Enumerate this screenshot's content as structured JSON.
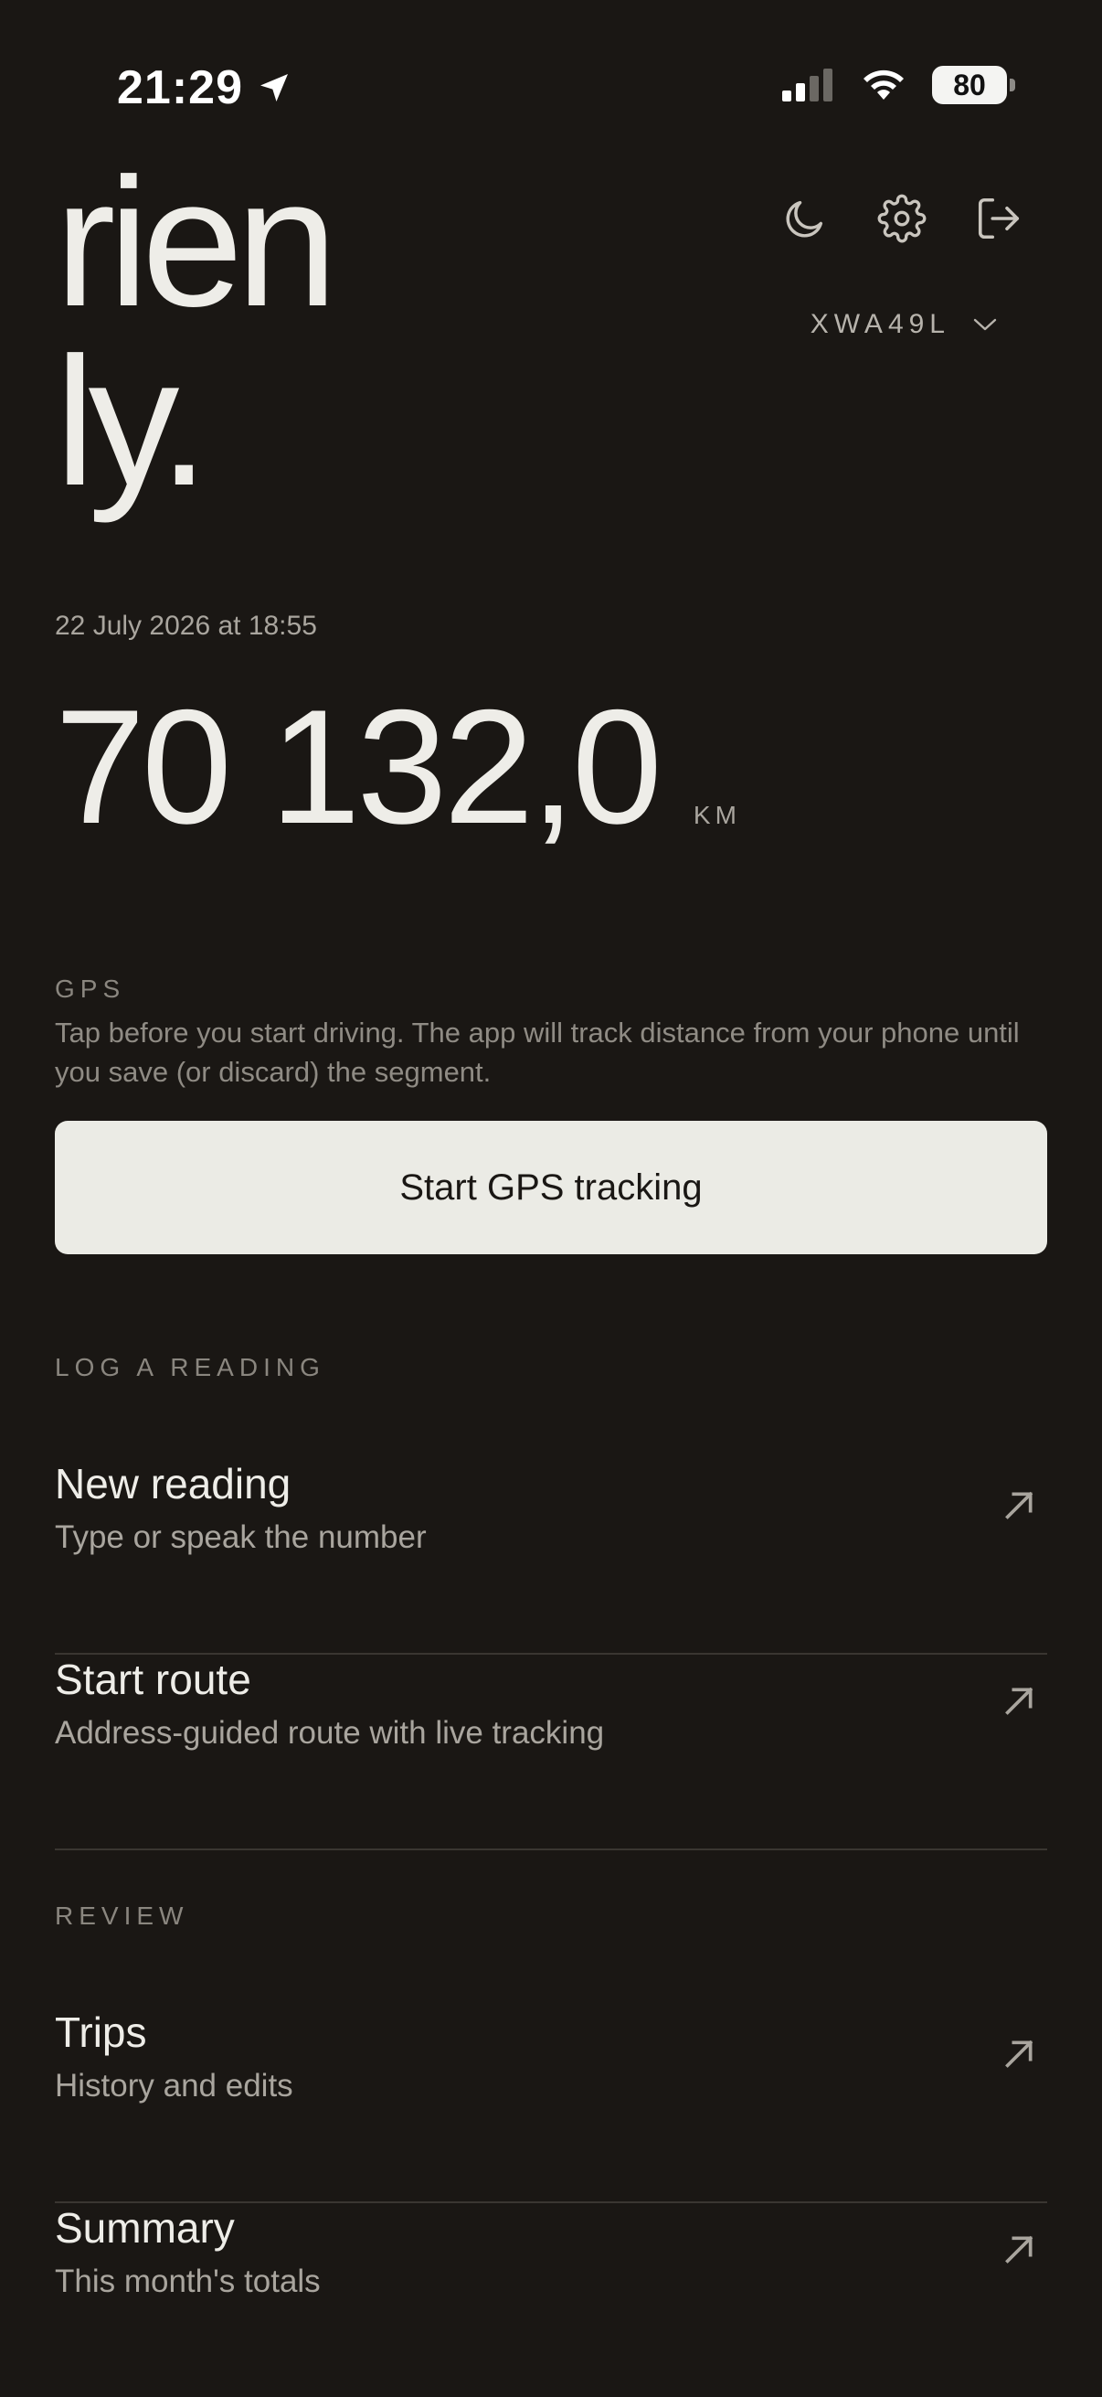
{
  "status_bar": {
    "time": "21:29",
    "battery": "80"
  },
  "brand": {
    "line1": "rien",
    "line2": "ly."
  },
  "vehicle": {
    "plate": "XWA49L"
  },
  "odometer": {
    "date": "22 July 2026 at 18:55",
    "value": "70 132,0",
    "unit": "KM"
  },
  "gps": {
    "label": "GPS",
    "description": "Tap before you start driving. The app will track distance from your phone until you save (or discard) the segment.",
    "button": "Start GPS tracking"
  },
  "log_section": {
    "label": "LOG A READING",
    "items": [
      {
        "title": "New reading",
        "subtitle": "Type or speak the number"
      },
      {
        "title": "Start route",
        "subtitle": "Address-guided route with live tracking"
      }
    ]
  },
  "review_section": {
    "label": "REVIEW",
    "items": [
      {
        "title": "Trips",
        "subtitle": "History and edits"
      },
      {
        "title": "Summary",
        "subtitle": "This month's totals"
      }
    ]
  },
  "colors": {
    "background": "#1a1714",
    "text": "#eeede8",
    "muted": "#a9a59e",
    "button": "#ebebe5"
  }
}
